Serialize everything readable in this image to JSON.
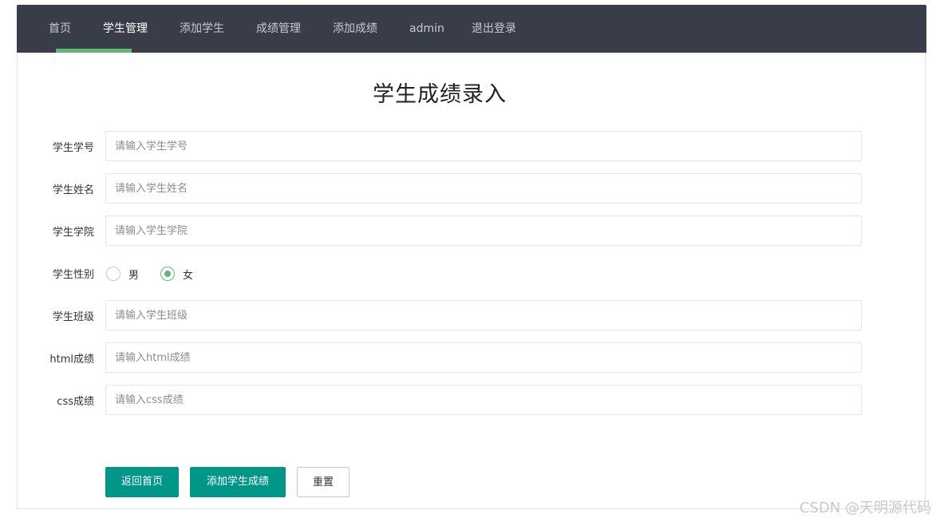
{
  "nav": {
    "items": [
      {
        "label": "首页"
      },
      {
        "label": "学生管理"
      },
      {
        "label": "添加学生"
      },
      {
        "label": "成绩管理"
      },
      {
        "label": "添加成绩"
      },
      {
        "label": "admin"
      },
      {
        "label": "退出登录"
      }
    ],
    "active_index": 1
  },
  "page": {
    "title": "学生成绩录入"
  },
  "form": {
    "student_id": {
      "label": "学生学号",
      "placeholder": "请输入学生学号",
      "value": ""
    },
    "student_name": {
      "label": "学生姓名",
      "placeholder": "请输入学生姓名",
      "value": ""
    },
    "student_college": {
      "label": "学生学院",
      "placeholder": "请输入学生学院",
      "value": ""
    },
    "gender": {
      "label": "学生性别",
      "options": [
        {
          "label": "男",
          "checked": false
        },
        {
          "label": "女",
          "checked": true
        }
      ]
    },
    "student_class": {
      "label": "学生班级",
      "placeholder": "请输入学生班级",
      "value": ""
    },
    "html_score": {
      "label": "html成绩",
      "placeholder": "请输入html成绩",
      "value": ""
    },
    "css_score": {
      "label": "css成绩",
      "placeholder": "请输入css成绩",
      "value": ""
    }
  },
  "buttons": {
    "back_home": "返回首页",
    "add_score": "添加学生成绩",
    "reset": "重置"
  },
  "watermark": "CSDN @天明源代码",
  "colors": {
    "nav_bg": "#393d49",
    "nav_active_underline": "#5fb878",
    "primary_button": "#009688",
    "radio_checked": "#5fb878"
  }
}
